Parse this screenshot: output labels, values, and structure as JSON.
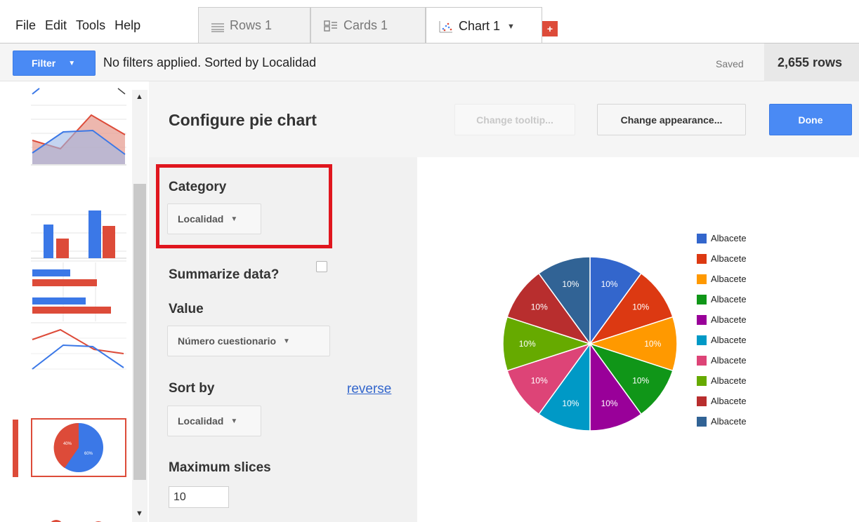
{
  "menu": [
    "File",
    "Edit",
    "Tools",
    "Help"
  ],
  "tabs": [
    {
      "label": "Rows 1",
      "icon": "rows-icon",
      "active": false
    },
    {
      "label": "Cards 1",
      "icon": "cards-icon",
      "active": false
    },
    {
      "label": "Chart 1",
      "icon": "chart-icon",
      "active": true
    }
  ],
  "tab_add": "+",
  "filterbar": {
    "filter_label": "Filter",
    "status": "No filters applied. Sorted by Localidad",
    "saved": "Saved",
    "row_count": "2,655 rows"
  },
  "header": {
    "title": "Configure pie chart",
    "tooltip_button": "Change tooltip...",
    "appearance_button": "Change appearance...",
    "done_button": "Done"
  },
  "config": {
    "category_label": "Category",
    "category_value": "Localidad",
    "summarize_label": "Summarize data?",
    "summarize_checked": false,
    "value_label": "Value",
    "value_value": "Número cuestionario",
    "sortby_label": "Sort by",
    "sortby_value": "Localidad",
    "reverse_link": "reverse",
    "maxslices_label": "Maximum slices",
    "maxslices_value": "10"
  },
  "colors": {
    "accent": "#4a8af4",
    "highlight": "#e0161e",
    "tab_add": "#dd4b39"
  },
  "chart_data": {
    "type": "pie",
    "slices": [
      {
        "label": "Albacete",
        "value": 10,
        "display": "10%",
        "color": "#3366cc"
      },
      {
        "label": "Albacete",
        "value": 10,
        "display": "10%",
        "color": "#dc3912"
      },
      {
        "label": "Albacete",
        "value": 10,
        "display": "10%",
        "color": "#ff9900"
      },
      {
        "label": "Albacete",
        "value": 10,
        "display": "10%",
        "color": "#109618"
      },
      {
        "label": "Albacete",
        "value": 10,
        "display": "10%",
        "color": "#990099"
      },
      {
        "label": "Albacete",
        "value": 10,
        "display": "10%",
        "color": "#0099c6"
      },
      {
        "label": "Albacete",
        "value": 10,
        "display": "10%",
        "color": "#dd4477"
      },
      {
        "label": "Albacete",
        "value": 10,
        "display": "10%",
        "color": "#66aa00"
      },
      {
        "label": "Albacete",
        "value": 10,
        "display": "10%",
        "color": "#b82e2e"
      },
      {
        "label": "Albacete",
        "value": 10,
        "display": "10%",
        "color": "#316395"
      }
    ],
    "legend_position": "right"
  },
  "thumbnails": {
    "pie_thumb_labels": [
      "40%",
      "60%"
    ]
  }
}
